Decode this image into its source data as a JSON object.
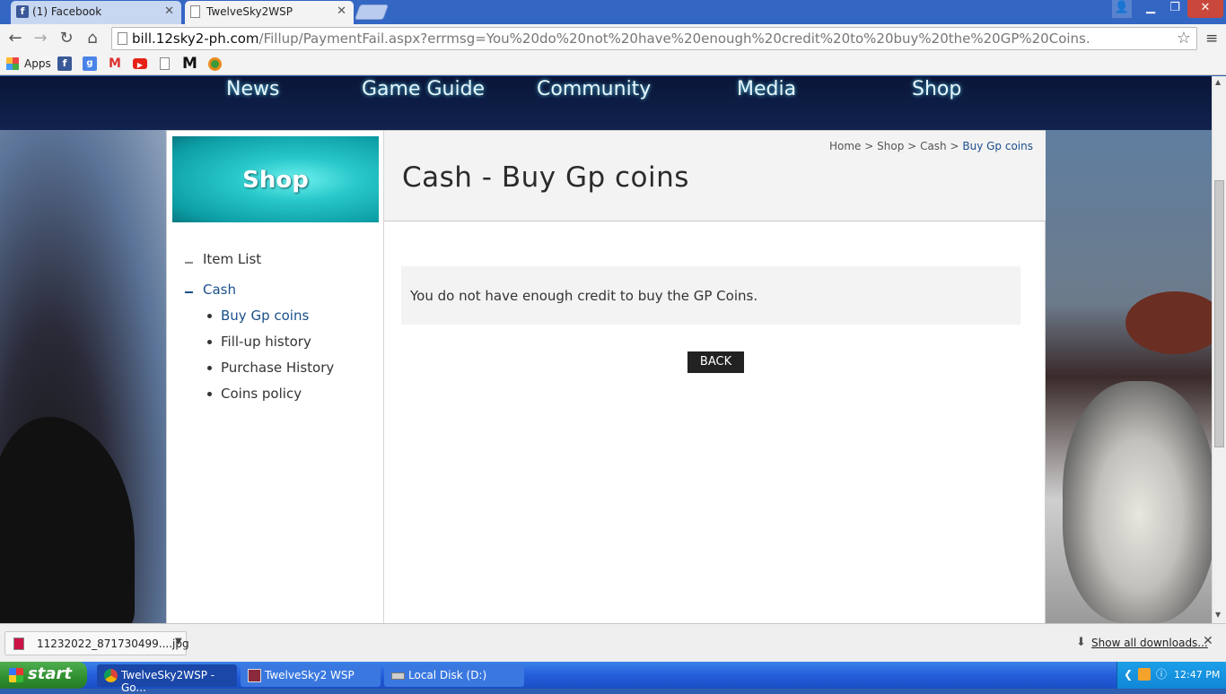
{
  "browser": {
    "tabs": [
      {
        "label": "(1) Facebook"
      },
      {
        "label": "TwelveSky2WSP"
      }
    ],
    "url_host": "bill.12sky2-ph.com",
    "url_rest": "/Fillup/PaymentFail.aspx?errmsg=You%20do%20not%20have%20enough%20credit%20to%20buy%20the%20GP%20Coins.",
    "bookmarks": {
      "apps_label": "Apps"
    }
  },
  "site": {
    "nav": [
      "News",
      "Game Guide",
      "Community",
      "Media",
      "Shop"
    ],
    "banner": "Shop",
    "breadcrumb": [
      "Home",
      ">",
      "Shop",
      ">",
      "Cash",
      ">",
      "Buy Gp coins"
    ],
    "title": "Cash - Buy Gp coins",
    "sidebar": {
      "item_list": "Item List",
      "cash": "Cash",
      "subitems": [
        "Buy Gp coins",
        "Fill-up history",
        "Purchase History",
        "Coins policy"
      ]
    },
    "message": "You do not have enough credit to buy the GP Coins.",
    "back_label": "BACK"
  },
  "downloads": {
    "file": "11232022_871730499....jpg",
    "show_all": "Show all downloads..."
  },
  "taskbar": {
    "start": "start",
    "tasks": [
      "TwelveSky2WSP - Go...",
      "TwelveSky2 WSP",
      "Local Disk (D:)"
    ],
    "clock": "12:47 PM"
  },
  "colors": {
    "accent_link": "#1b4f8a",
    "taskbar_blue": "#245edb",
    "start_green": "#2f8f2f"
  }
}
